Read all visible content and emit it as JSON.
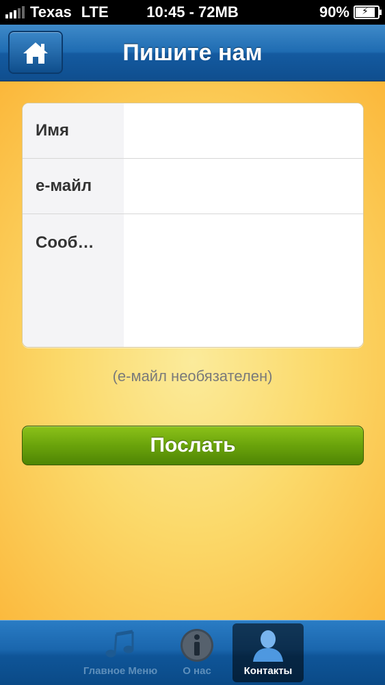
{
  "status_bar": {
    "carrier": "Texas",
    "network": "LTE",
    "time_memory": "10:45 - 72MB",
    "battery": "90%",
    "battery_level": 0.9
  },
  "nav": {
    "title": "Пишите нам",
    "home_icon": "home-icon"
  },
  "form": {
    "name_label": "Имя",
    "name_value": "",
    "email_label": "е-майл",
    "email_value": "",
    "message_label": "Сооб…",
    "message_value": ""
  },
  "hint": "(е-майл необязателен)",
  "send_label": "Послать",
  "tabs": [
    {
      "label": "Главное Меню",
      "icon": "music-notes-icon",
      "selected": false
    },
    {
      "label": "О нас",
      "icon": "info-icon",
      "selected": false
    },
    {
      "label": "Контакты",
      "icon": "person-icon",
      "selected": true
    }
  ],
  "colors": {
    "nav_blue": "#1f6cb2",
    "send_green": "#6aa30b",
    "background_yellow": "#fbd96a",
    "tab_selected_label": "#ffffff"
  }
}
